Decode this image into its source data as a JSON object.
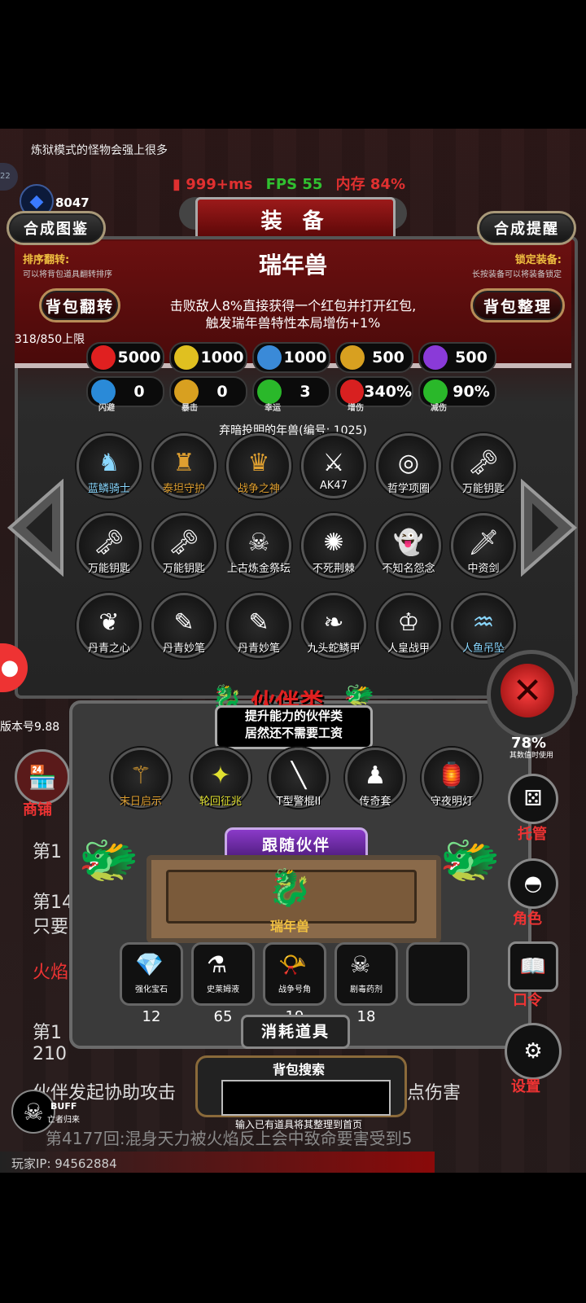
{
  "notice": "炼狱模式的怪物会强上很多",
  "perf": {
    "ping": "999+ms",
    "fps": "FPS 55",
    "memory": "内存 84%"
  },
  "currency": {
    "value": "8047"
  },
  "badge_left": "22",
  "title": "装 备",
  "buttons": {
    "synth_catalog": "合成图鉴",
    "synth_remind": "合成提醒",
    "bag_flip": "背包翻转",
    "bag_sort": "背包整理"
  },
  "sort_flip": {
    "title": "排序翻转:",
    "desc": "可以将背包道具翻转排序"
  },
  "lock_equip": {
    "title": "锁定装备:",
    "desc": "长按装备可以将装备锁定"
  },
  "item": {
    "name": "瑞年兽",
    "desc_line1": "击败敌人8%直接获得一个红包并打开红包,",
    "desc_line2": "触发瑞年兽特性本局增伤+1%",
    "caption": "弃暗投明的年兽(编号: 1025)"
  },
  "capacity": "318/850上限",
  "stats_row1": [
    {
      "icon": "heart-icon",
      "value": "5000",
      "color": "#e02020"
    },
    {
      "icon": "strength-icon",
      "value": "1000",
      "color": "#e0c020"
    },
    {
      "icon": "armor-icon",
      "value": "1000",
      "color": "#3a8ad8"
    },
    {
      "icon": "sword-icon",
      "value": "500",
      "color": "#d8a020"
    },
    {
      "icon": "lightning-icon",
      "value": "500",
      "color": "#8a3ad8"
    }
  ],
  "stats_row2": [
    {
      "icon": "dodge-icon",
      "value": "0",
      "label": "闪避",
      "color": "#2a8ad8"
    },
    {
      "icon": "crit-icon",
      "value": "0",
      "label": "暴击",
      "color": "#d8a020"
    },
    {
      "icon": "clover-icon",
      "value": "3",
      "label": "幸运",
      "color": "#2ab82a"
    },
    {
      "icon": "damage-icon",
      "value": "340%",
      "label": "增伤",
      "color": "#d82020"
    },
    {
      "icon": "shield-icon",
      "value": "90%",
      "label": "减伤",
      "color": "#2ab82a"
    }
  ],
  "equipment": [
    {
      "name": "蓝鳞骑士",
      "color": "#8ad8ff",
      "icon": "♞"
    },
    {
      "name": "泰坦守护",
      "color": "#e0a030",
      "icon": "♜"
    },
    {
      "name": "战争之神",
      "color": "#e0a030",
      "icon": "♛"
    },
    {
      "name": "AK47",
      "color": "#ffffff",
      "icon": "⚔"
    },
    {
      "name": "哲学项圈",
      "color": "#ffffff",
      "icon": "◎"
    },
    {
      "name": "万能钥匙",
      "color": "#ffffff",
      "icon": "🗝"
    },
    {
      "name": "万能钥匙",
      "color": "#ffffff",
      "icon": "🗝"
    },
    {
      "name": "万能钥匙",
      "color": "#ffffff",
      "icon": "🗝"
    },
    {
      "name": "上古炼金祭坛",
      "color": "#ffffff",
      "icon": "☠"
    },
    {
      "name": "不死荆棘",
      "color": "#ffffff",
      "icon": "✺"
    },
    {
      "name": "不知名怨念",
      "color": "#ffffff",
      "icon": "👻"
    },
    {
      "name": "中资剑",
      "color": "#ffffff",
      "icon": "🗡"
    },
    {
      "name": "丹青之心",
      "color": "#ffffff",
      "icon": "❦"
    },
    {
      "name": "丹青妙笔",
      "color": "#ffffff",
      "icon": "✎"
    },
    {
      "name": "丹青妙笔",
      "color": "#ffffff",
      "icon": "✎"
    },
    {
      "name": "九头蛇鳞甲",
      "color": "#ffffff",
      "icon": "❧"
    },
    {
      "name": "人皇战甲",
      "color": "#ffffff",
      "icon": "♔"
    },
    {
      "name": "人鱼吊坠",
      "color": "#8ad8ff",
      "icon": "♒"
    }
  ],
  "partner_section": {
    "title": "伙伴类",
    "tooltip_line1": "提升能力的伙伴类",
    "tooltip_line2": "居然还不需要工资"
  },
  "partners": [
    {
      "name": "末日启示",
      "color": "#e0a030",
      "icon": "⚚"
    },
    {
      "name": "轮回征兆",
      "color": "#e0e030",
      "icon": "✦"
    },
    {
      "name": "T型警棍II",
      "color": "#ffffff",
      "icon": "╲"
    },
    {
      "name": "传奇套",
      "color": "#ffffff",
      "icon": "♟"
    },
    {
      "name": "守夜明灯",
      "color": "#ffffff",
      "icon": "🏮"
    }
  ],
  "follow_partner": {
    "title": "跟随伙伴",
    "name": "瑞年兽"
  },
  "consumables_title": "消耗道具",
  "consumables": [
    {
      "name": "强化宝石",
      "count": "12",
      "icon": "💎"
    },
    {
      "name": "史莱姆液",
      "count": "65",
      "icon": "⚗"
    },
    {
      "name": "战争号角",
      "count": "19",
      "icon": "📯"
    },
    {
      "name": "剧毒药剂",
      "count": "18",
      "icon": "☠"
    }
  ],
  "bag_search": {
    "title": "背包搜索",
    "hint": "输入已有道具将其整理到首页",
    "value": ""
  },
  "sidebar": {
    "shop": "商铺",
    "manage": "托管",
    "role": "角色",
    "code": "口令",
    "settings": "设置",
    "hidden_value": "78%",
    "hidden_caption": "其数值时使用"
  },
  "version": "版本号9.88",
  "log": {
    "l1": "第1",
    "l2": "第14",
    "l3": "只要",
    "l4": "火焰",
    "l5": "第1",
    "l6": "210",
    "assist": "伙伴发起协助攻击",
    "assist_tail": "点伤害",
    "bottom": "第4177回:混身天力被火焰反上会中致命要害受到5"
  },
  "buff": {
    "label": "BUFF",
    "sub": "亡者归来"
  },
  "player_ip": "玩家IP: 94562884"
}
